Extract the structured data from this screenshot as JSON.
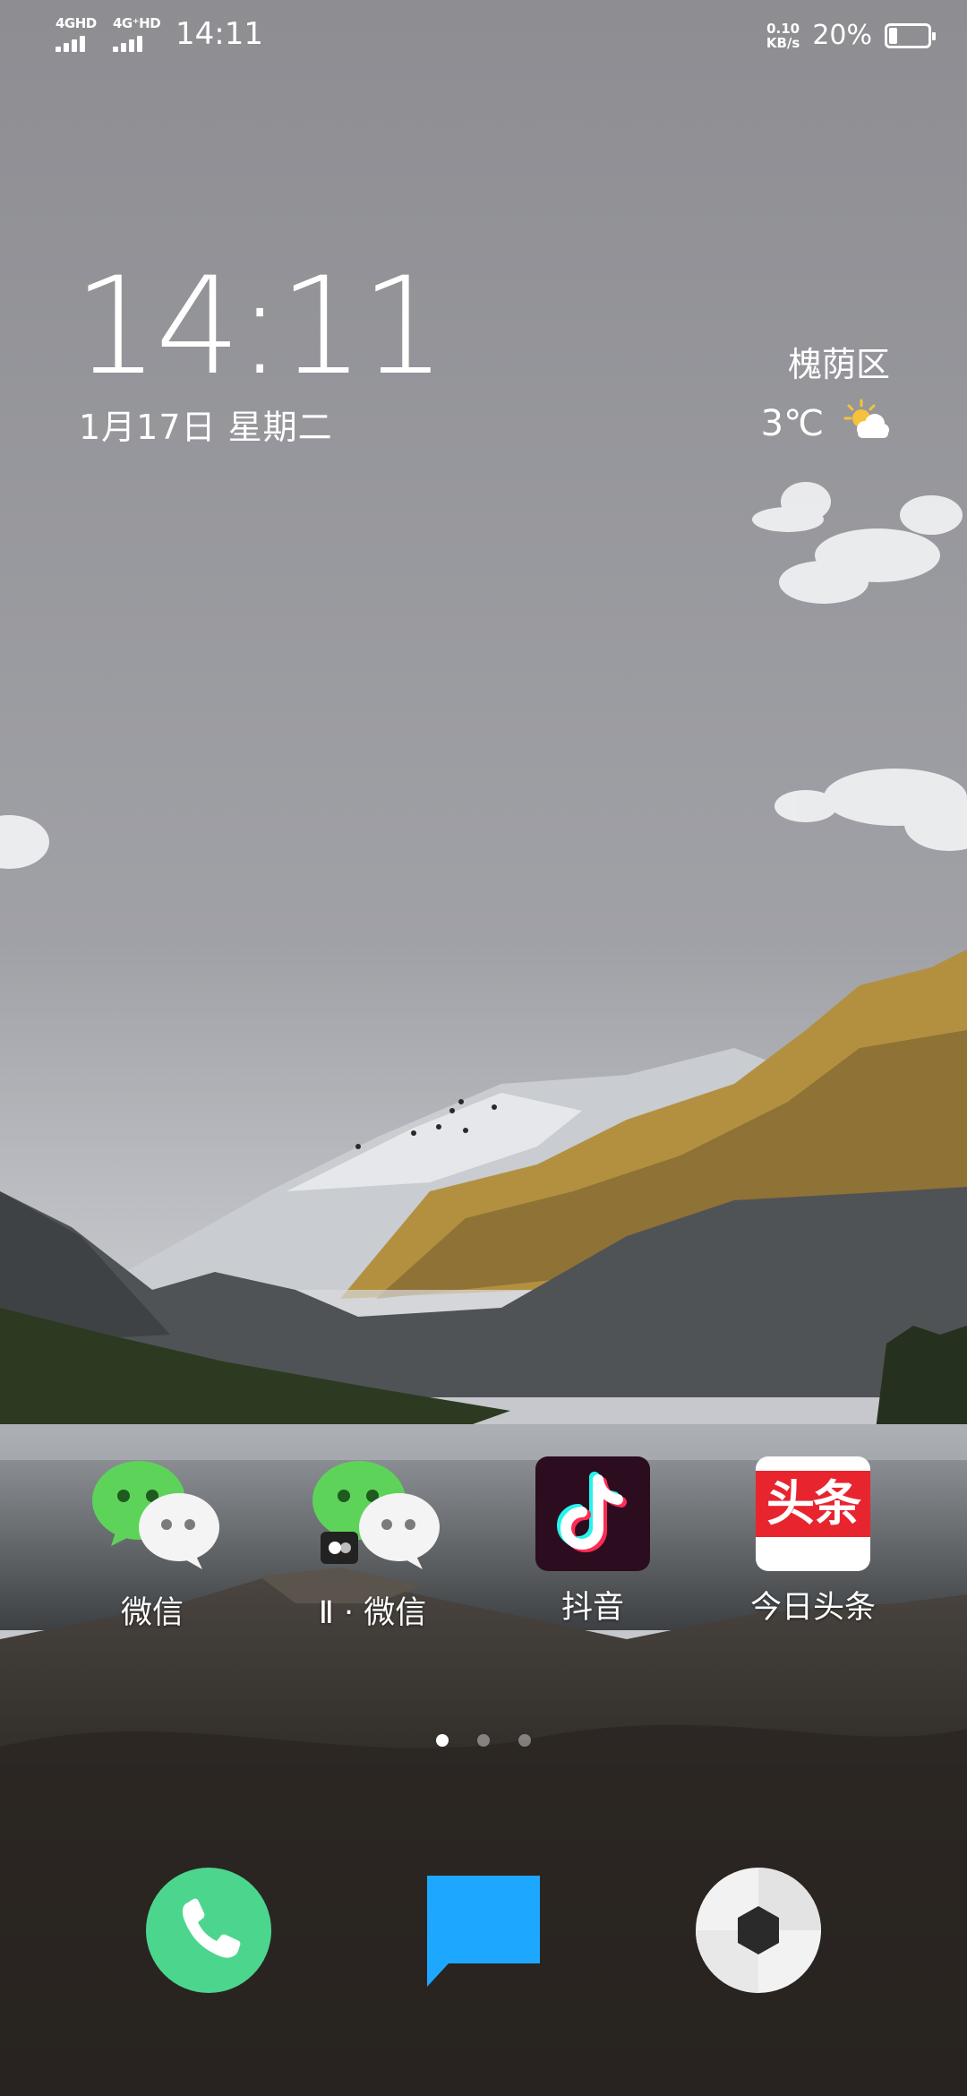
{
  "status_bar": {
    "sim1_label": "4GHD",
    "sim2_label": "4G⁺HD",
    "time": "14:11",
    "net_speed_value": "0.10",
    "net_speed_unit": "KB/s",
    "battery_percent_text": "20%",
    "battery_level": 0.2
  },
  "clock_widget": {
    "time": "14:11",
    "date": "1月17日 星期二"
  },
  "weather_widget": {
    "location": "槐荫区",
    "temperature": "3℃",
    "condition_icon": "partly-cloudy-icon"
  },
  "apps": [
    {
      "label": "微信",
      "icon": "wechat-icon"
    },
    {
      "label": "Ⅱ · 微信",
      "icon": "wechat-clone-icon"
    },
    {
      "label": "抖音",
      "icon": "douyin-icon"
    },
    {
      "label": "今日头条",
      "icon": "toutiao-icon",
      "icon_text": "头条"
    }
  ],
  "page_indicator": {
    "total": 3,
    "current": 1
  },
  "dock": [
    {
      "icon": "phone-icon"
    },
    {
      "icon": "messages-icon"
    },
    {
      "icon": "browser-icon"
    }
  ],
  "colors": {
    "wechat_green": "#5ed35a",
    "phone_green": "#4cd68d",
    "messages_blue": "#1ea7ff",
    "toutiao_red": "#e8252f",
    "douyin_bg": "#2b0d1f"
  }
}
